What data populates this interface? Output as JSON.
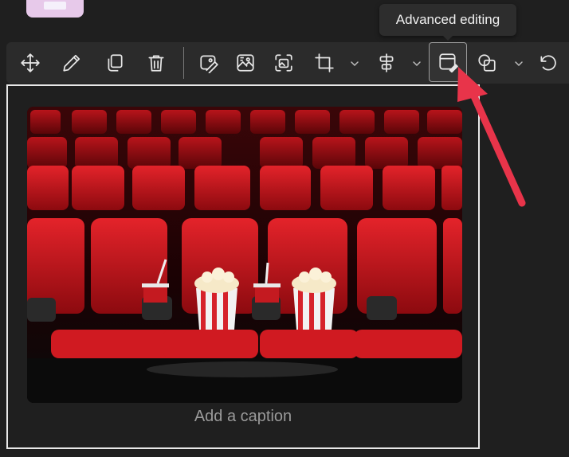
{
  "tooltip": {
    "text": "Advanced editing"
  },
  "toolbar": {
    "buttons": [
      {
        "name": "move",
        "icon": "move-arrows-icon",
        "label": "Move"
      },
      {
        "name": "edit",
        "icon": "pencil-icon",
        "label": "Edit"
      },
      {
        "name": "duplicate",
        "icon": "copy-icon",
        "label": "Duplicate"
      },
      {
        "name": "delete",
        "icon": "trash-icon",
        "label": "Delete"
      },
      {
        "name": "image-edit",
        "icon": "image-edit-icon",
        "label": "Edit image"
      },
      {
        "name": "replace-image",
        "icon": "image-replace-icon",
        "label": "Replace image"
      },
      {
        "name": "alt-text",
        "icon": "image-frame-icon",
        "label": "Image frame"
      },
      {
        "name": "crop",
        "icon": "crop-icon",
        "label": "Crop"
      },
      {
        "name": "align",
        "icon": "align-center-icon",
        "label": "Align"
      },
      {
        "name": "advanced-editing",
        "icon": "advanced-edit-icon",
        "label": "Advanced editing"
      },
      {
        "name": "shapes",
        "icon": "shapes-icon",
        "label": "Shapes"
      },
      {
        "name": "undo",
        "icon": "undo-icon",
        "label": "Undo"
      }
    ]
  },
  "image": {
    "description_alt": "Red cinema seats with popcorn and drinks"
  },
  "caption": {
    "placeholder": "Add a caption"
  },
  "colors": {
    "background": "#1f1f1f",
    "toolbar": "#2b2b2b",
    "annotation_arrow": "#e8344a",
    "seat_red": "#c8141b"
  }
}
